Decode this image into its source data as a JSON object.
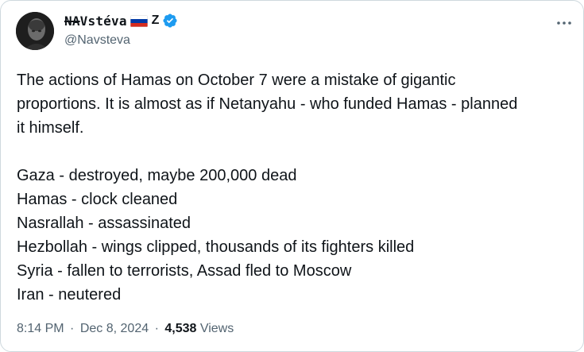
{
  "author": {
    "display_name_struck": "NA",
    "display_name_rest": "Vstéva",
    "flag": "russia-flag",
    "suffix": "Z",
    "handle": "@Navsteva",
    "verified": true
  },
  "tweet": {
    "lines_para1": [
      "The actions of Hamas on October 7 were a mistake of gigantic",
      "proportions. It is almost as if Netanyahu - who funded Hamas - planned",
      "it himself."
    ],
    "lines_para2": [
      "Gaza - destroyed, maybe 200,000 dead",
      "Hamas - clock cleaned",
      "Nasrallah - assassinated",
      "Hezbollah - wings clipped, thousands of its fighters killed",
      "Syria - fallen to terrorists, Assad fled to Moscow",
      "Iran - neutered"
    ]
  },
  "meta": {
    "time": "8:14 PM",
    "separator": "·",
    "date": "Dec 8, 2024",
    "views_count": "4,538",
    "views_label": "Views"
  },
  "colors": {
    "verified_blue": "#1d9bf0",
    "secondary_text": "#536471",
    "primary_text": "#0f1419"
  }
}
